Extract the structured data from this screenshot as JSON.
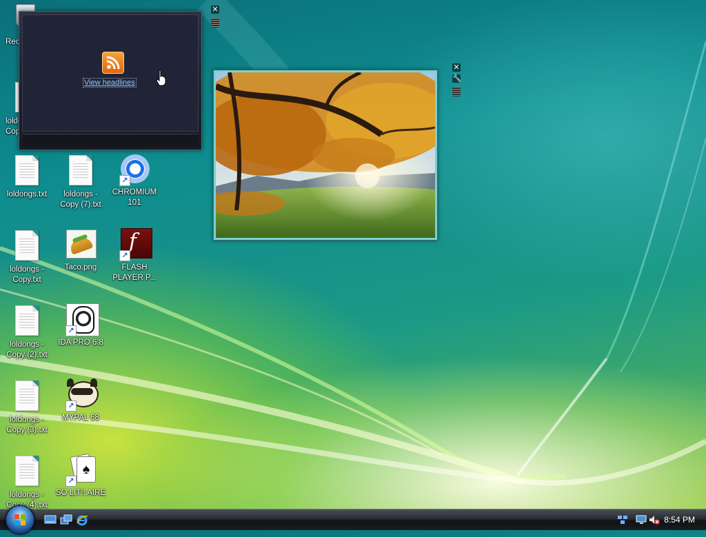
{
  "desktop": {
    "icons": [
      {
        "label": "Rec",
        "icon": "recycle-bin-icon"
      },
      {
        "label": "loldong Copy",
        "icon": "text-file-icon"
      },
      {
        "label": "loldongs.txt",
        "icon": "text-file-icon"
      },
      {
        "label": "loldongs - Copy (7).txt",
        "icon": "text-file-icon"
      },
      {
        "label": "CHROMIUM 101",
        "icon": "chromium-icon"
      },
      {
        "label": "loldongs - Copy.txt",
        "icon": "text-file-icon"
      },
      {
        "label": "Taco.png",
        "icon": "taco-image-icon"
      },
      {
        "label": "FLASH PLAYER P...",
        "icon": "flash-player-icon"
      },
      {
        "label": "loldongs - Copy (2).txt",
        "icon": "text-file-icon"
      },
      {
        "label": "IDA PRO 6.8",
        "icon": "ida-pro-icon"
      },
      {
        "label": "loldongs - Copy (3).txt",
        "icon": "text-file-icon"
      },
      {
        "label": "MYPAL 68",
        "icon": "mypal-raccoon-icon"
      },
      {
        "label": "loldongs - Copy (4).txt",
        "icon": "text-file-icon"
      },
      {
        "label": "SO LIT!! AIRE",
        "icon": "solitaire-cards-icon"
      }
    ]
  },
  "gadgets": {
    "feed": {
      "link": "View headlines",
      "icon": "rss-icon"
    },
    "picture": {
      "subject": "autumn-tree-landscape"
    }
  },
  "taskbar": {
    "quick_launch": [
      "show-desktop-icon",
      "switch-windows-icon",
      "internet-explorer-icon"
    ],
    "tray_icons": [
      "network-icon",
      "monitor-icon",
      "volume-muted-icon"
    ],
    "clock": "8:54 PM"
  },
  "colors": {
    "accent": "#1b9a86",
    "taskbar": "#1a1d20"
  }
}
